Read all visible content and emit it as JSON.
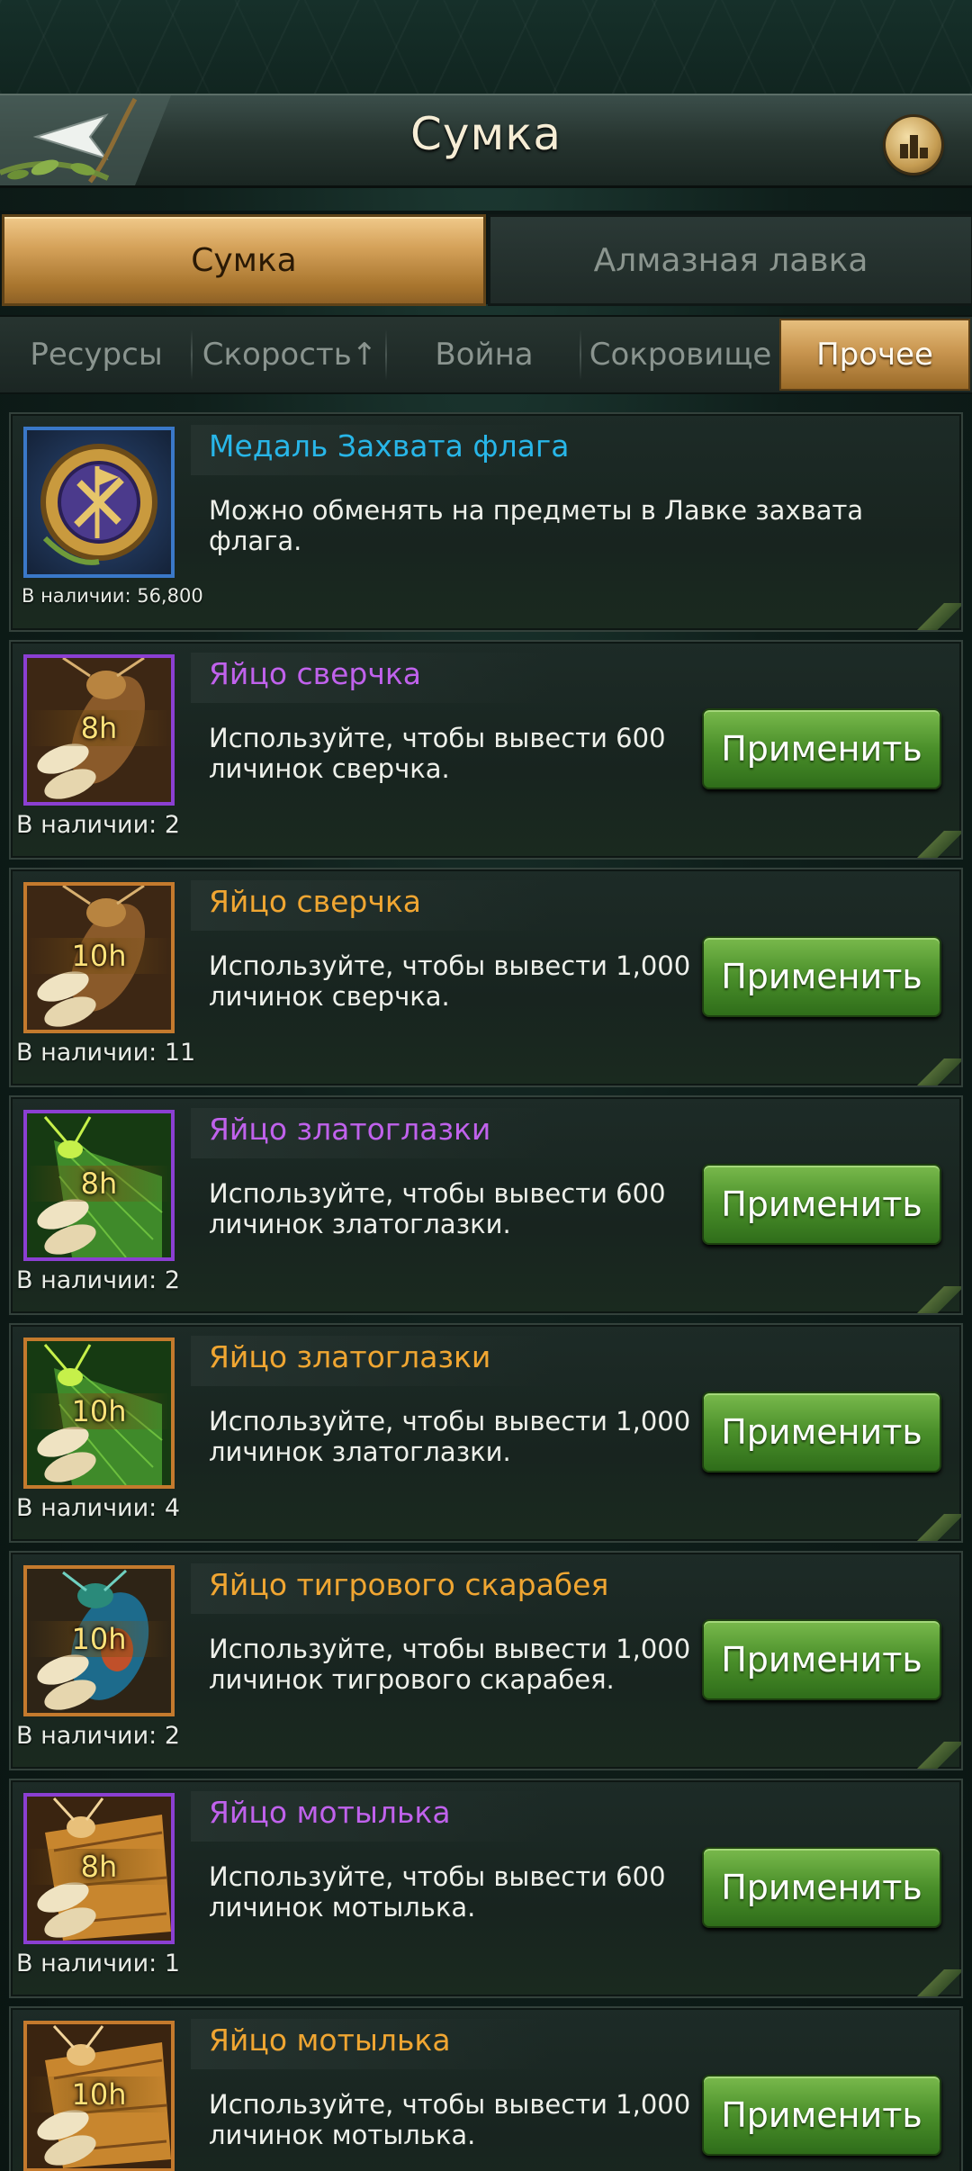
{
  "header": {
    "title": "Сумка",
    "back_icon": "back-arrow-icon",
    "rank_icon": "ranking-icon"
  },
  "main_tabs": [
    {
      "label": "Сумка",
      "active": true
    },
    {
      "label": "Алмазная лавка",
      "active": false
    }
  ],
  "sub_tabs": [
    {
      "label": "Ресурсы",
      "active": false
    },
    {
      "label": "Скорость↑",
      "active": false
    },
    {
      "label": "Война",
      "active": false
    },
    {
      "label": "Сокровище",
      "active": false
    },
    {
      "label": "Прочее",
      "active": true
    }
  ],
  "items": [
    {
      "name": "Медаль Захвата флага",
      "rarity_color": "#28b6e8",
      "description": "Можно обменять на предметы в Лавке захвата флага.",
      "quantity": "В наличии: 56,800",
      "timer": "",
      "icon": "flag-medal-icon",
      "button": ""
    },
    {
      "name": "Яйцо сверчка",
      "rarity_color": "#c062ec",
      "description": "Используйте, чтобы вывести 600 личинок сверчка.",
      "quantity": "В наличии: 2",
      "timer": "8h",
      "icon": "cricket-egg-icon",
      "button": "Применить"
    },
    {
      "name": "Яйцо сверчка",
      "rarity_color": "#f0a632",
      "description": "Используйте, чтобы вывести 1,000 личинок сверчка.",
      "quantity": "В наличии: 11",
      "timer": "10h",
      "icon": "cricket-egg-icon",
      "button": "Применить"
    },
    {
      "name": "Яйцо златоглазки",
      "rarity_color": "#c062ec",
      "description": "Используйте, чтобы вывести 600 личинок златоглазки.",
      "quantity": "В наличии: 2",
      "timer": "8h",
      "icon": "lacewing-egg-icon",
      "button": "Применить"
    },
    {
      "name": "Яйцо златоглазки",
      "rarity_color": "#f0a632",
      "description": "Используйте, чтобы вывести 1,000 личинок златоглазки.",
      "quantity": "В наличии: 4",
      "timer": "10h",
      "icon": "lacewing-egg-icon",
      "button": "Применить"
    },
    {
      "name": "Яйцо тигрового скарабея",
      "rarity_color": "#f0a632",
      "description": "Используйте, чтобы вывести 1,000 личинок тигрового скарабея.",
      "quantity": "В наличии: 2",
      "timer": "10h",
      "icon": "tiger-beetle-egg-icon",
      "button": "Применить"
    },
    {
      "name": "Яйцо мотылька",
      "rarity_color": "#c062ec",
      "description": "Используйте, чтобы вывести 600 личинок мотылька.",
      "quantity": "В наличии: 1",
      "timer": "8h",
      "icon": "moth-egg-icon",
      "button": "Применить"
    },
    {
      "name": "Яйцо мотылька",
      "rarity_color": "#f0a632",
      "description": "Используйте, чтобы вывести 1,000 личинок мотылька.",
      "quantity": "",
      "timer": "10h",
      "icon": "moth-egg-icon",
      "button": "Применить"
    }
  ]
}
